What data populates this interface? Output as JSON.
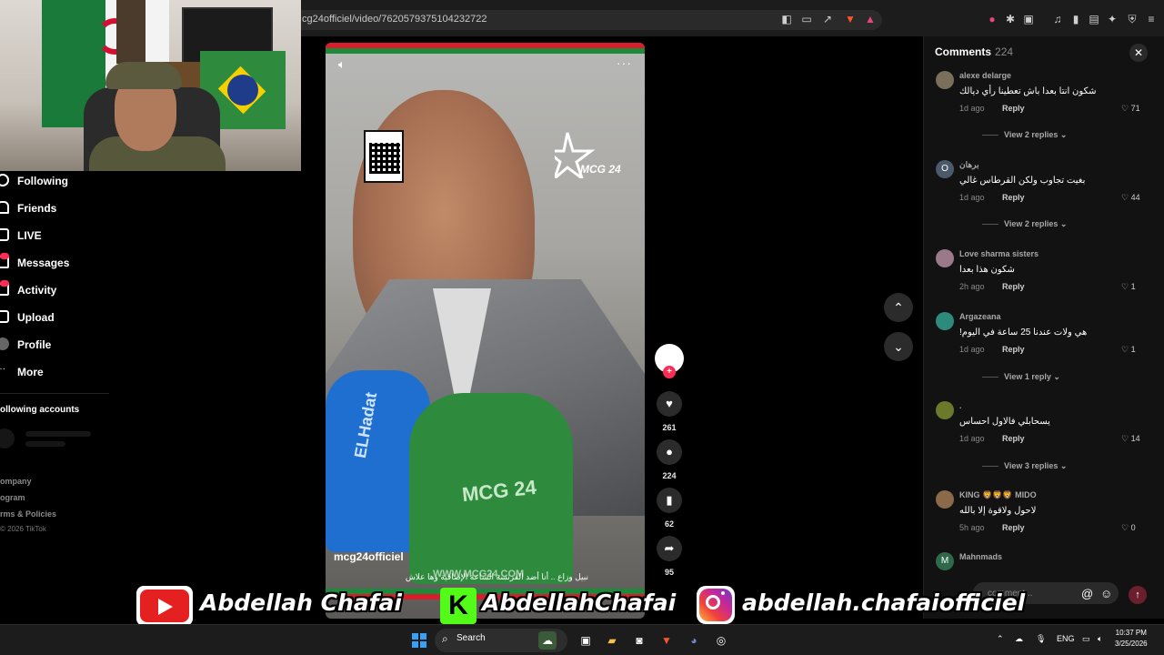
{
  "browser": {
    "url": "cg24officiel/video/7620579375104232722"
  },
  "sidebar": {
    "items": [
      {
        "label": "Following",
        "icon": "following-icon"
      },
      {
        "label": "Friends",
        "icon": "friends-icon"
      },
      {
        "label": "LIVE",
        "icon": "live-icon"
      },
      {
        "label": "Messages",
        "icon": "messages-icon"
      },
      {
        "label": "Activity",
        "icon": "activity-icon"
      },
      {
        "label": "Upload",
        "icon": "upload-icon"
      },
      {
        "label": "Profile",
        "icon": "profile-icon"
      },
      {
        "label": "More",
        "icon": "more-icon"
      }
    ],
    "following_accounts": "ollowing accounts",
    "footer": [
      "ompany",
      "ogram",
      "rms & Policies"
    ],
    "copyright": "2026 TikTok"
  },
  "video": {
    "author": "mcg24officiel",
    "description": "نبيل وزاع .. أنا أضد الفرنسة الساعة الإضافية وها علاش",
    "watermark": "WWW.MCG24.COM",
    "logo_text": "MCG 24",
    "mic_green_label": "MCG 24",
    "mic_blue_label": "ELHadat"
  },
  "actions": {
    "likes": "261",
    "comments": "224",
    "saves": "62",
    "shares": "95"
  },
  "comments_panel": {
    "title": "Comments",
    "count": "224",
    "input_placeholder": "comment...",
    "items": [
      {
        "name": "alexe delarge",
        "text": "شكون انتا بعدا باش تعطينا رأي ديالك",
        "time": "1d ago",
        "reply": "Reply",
        "likes": "71",
        "view_replies": "View 2 replies",
        "avatar": ""
      },
      {
        "name": "برهان",
        "text": "بغيت تجاوب ولكن القرطاس غالي",
        "time": "1d ago",
        "reply": "Reply",
        "likes": "44",
        "view_replies": "View 2 replies",
        "avatar": "O"
      },
      {
        "name": "Love sharma sisters",
        "text": "شكون هذا بعدا",
        "time": "2h ago",
        "reply": "Reply",
        "likes": "1",
        "view_replies": "",
        "avatar": ""
      },
      {
        "name": "Argazeana",
        "text": "!هي ولات عندنا 25 ساعة في اليوم",
        "time": "1d ago",
        "reply": "Reply",
        "likes": "1",
        "view_replies": "View 1 reply",
        "avatar": ""
      },
      {
        "name": ".",
        "text": "يسحابلي فالاول احساس",
        "time": "1d ago",
        "reply": "Reply",
        "likes": "14",
        "view_replies": "View 3 replies",
        "avatar": ""
      },
      {
        "name": "KING 🦁🦁🦁 MIDO",
        "text": "لاحول ولاقوة إلا بالله",
        "time": "5h ago",
        "reply": "Reply",
        "likes": "0",
        "view_replies": "",
        "avatar": ""
      },
      {
        "name": "Mahnmads",
        "text": "",
        "time": "",
        "reply": "",
        "likes": "",
        "view_replies": "",
        "avatar": "M"
      }
    ]
  },
  "banner": {
    "youtube": "Abdellah Chafai",
    "kick": "AbdellahChafai",
    "instagram": "abdellah.chafaiofficiel"
  },
  "taskbar": {
    "search": "Search",
    "lang": "ENG",
    "time": "10:37 PM",
    "date": "3/25/2026"
  }
}
